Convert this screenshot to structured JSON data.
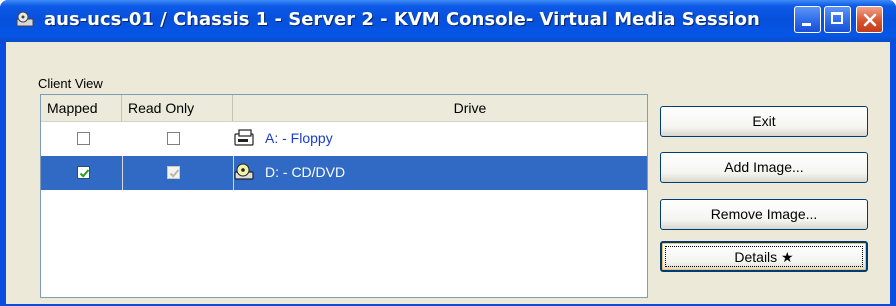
{
  "window": {
    "title": "aus-ucs-01 / Chassis 1 - Server 2 - KVM Console- Virtual Media Session",
    "icon": "virtual-media-icon"
  },
  "client_view": {
    "label": "Client View",
    "columns": [
      "Mapped",
      "Read Only",
      "Drive"
    ],
    "rows": [
      {
        "mapped": false,
        "read_only": false,
        "drive": "A: - Floppy",
        "icon": "floppy-drive-icon",
        "selected": false
      },
      {
        "mapped": true,
        "read_only": true,
        "drive": "D: - CD/DVD",
        "icon": "cd-dvd-drive-icon",
        "selected": true
      }
    ]
  },
  "buttons": {
    "exit": "Exit",
    "add_image": "Add Image...",
    "remove_image": "Remove Image...",
    "details": "Details ★"
  },
  "colors": {
    "titlebar": "#0650dc",
    "selection": "#316ac5",
    "dialog_bg": "#ece9d8"
  }
}
